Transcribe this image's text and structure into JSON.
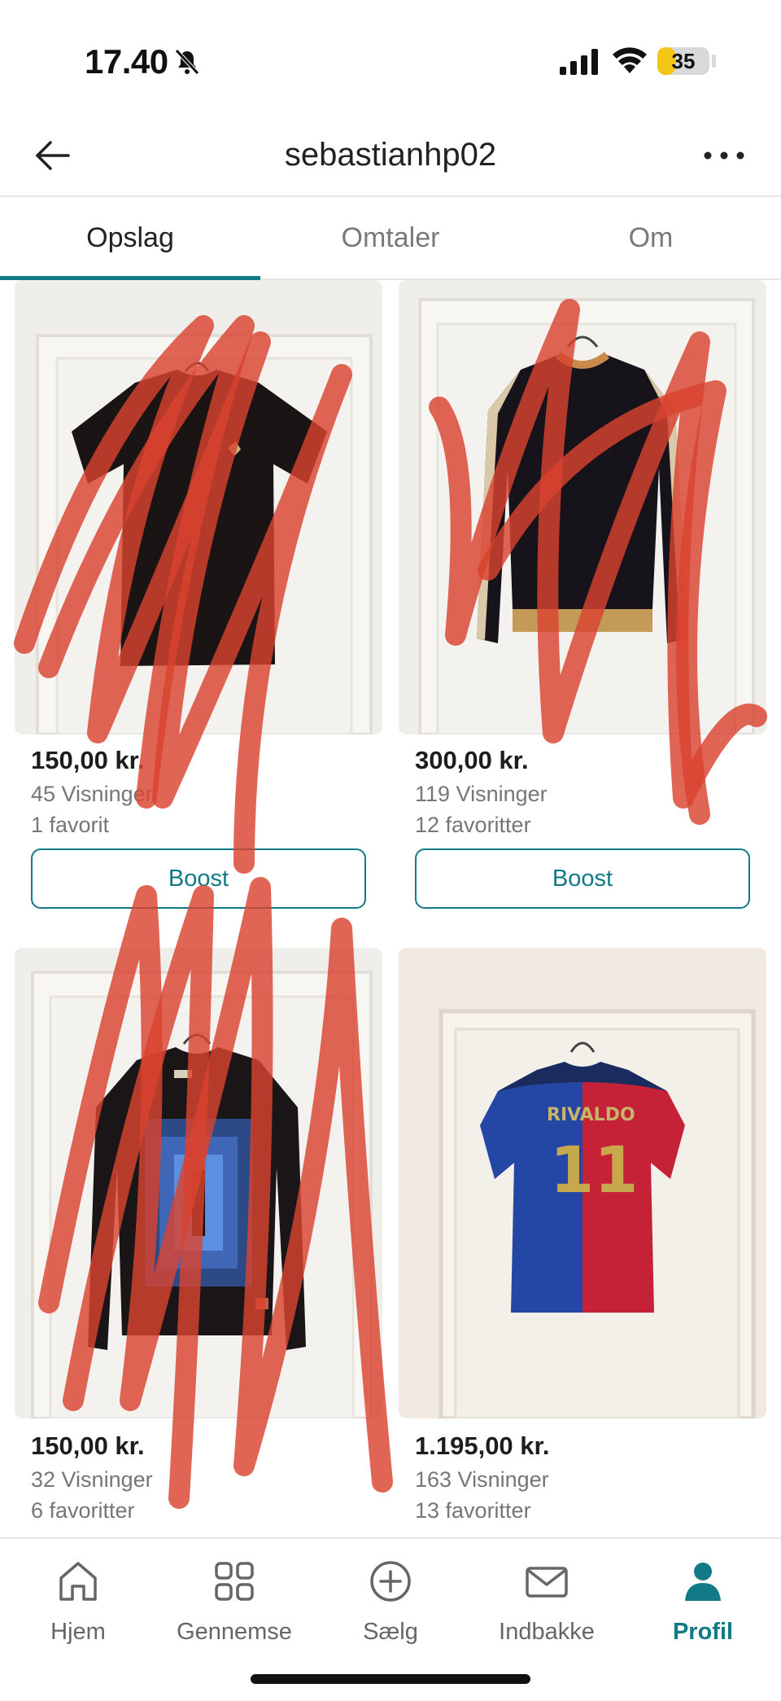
{
  "status_bar": {
    "time": "17.40",
    "battery": "35",
    "battery_level_percent": 35
  },
  "header": {
    "title": "sebastianhp02"
  },
  "tabs": [
    {
      "label": "Opslag",
      "active": true
    },
    {
      "label": "Omtaler",
      "active": false
    },
    {
      "label": "Om",
      "active": false
    }
  ],
  "listings": [
    {
      "price": "150,00 kr.",
      "views": "45 Visninger",
      "favorites": "1 favorit",
      "button": "Boost"
    },
    {
      "price": "300,00 kr.",
      "views": "119 Visninger",
      "favorites": "12 favoritter",
      "button": "Boost"
    },
    {
      "price": "150,00 kr.",
      "views": "32 Visninger",
      "favorites": "6 favoritter"
    },
    {
      "price": "1.195,00 kr.",
      "views": "163 Visninger",
      "favorites": "13 favoritter",
      "jersey_name": "RIVALDO",
      "jersey_number": "11"
    }
  ],
  "bottom_nav": [
    {
      "label": "Hjem",
      "icon": "home-icon",
      "active": false
    },
    {
      "label": "Gennemse",
      "icon": "grid-icon",
      "active": false
    },
    {
      "label": "Sælg",
      "icon": "plus-circle-icon",
      "active": false
    },
    {
      "label": "Indbakke",
      "icon": "mail-icon",
      "active": false
    },
    {
      "label": "Profil",
      "icon": "profile-icon",
      "active": true
    }
  ],
  "colors": {
    "accent": "#127a86",
    "scribble": "#d9432f"
  }
}
